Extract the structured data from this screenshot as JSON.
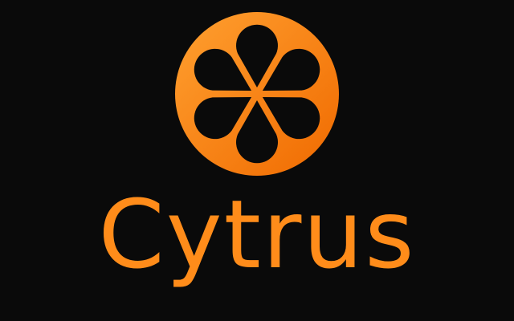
{
  "brand": {
    "name": "Cytrus",
    "colors": {
      "background": "#0a0a0a",
      "primary": "#ff8c1a",
      "gradient_light": "#ffa030",
      "gradient_dark": "#f06a00",
      "segment_fill": "#0a0a0a"
    },
    "logo": {
      "icon": "citrus-slice-icon",
      "segments": 6
    }
  }
}
